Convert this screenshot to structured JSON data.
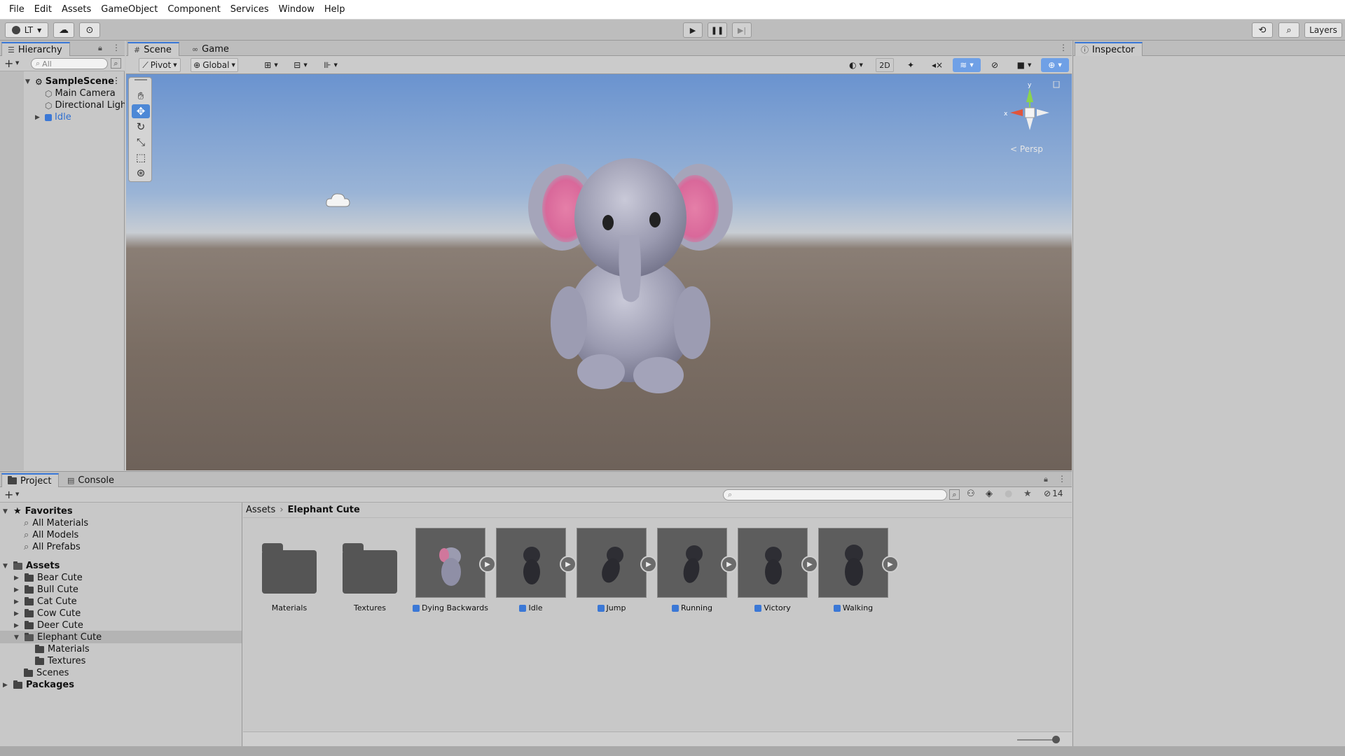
{
  "menu": [
    "File",
    "Edit",
    "Assets",
    "GameObject",
    "Component",
    "Services",
    "Window",
    "Help"
  ],
  "toolbar": {
    "account_label": "LT",
    "layers_label": "Layers"
  },
  "hierarchy": {
    "tab_label": "Hierarchy",
    "search_placeholder": "All",
    "scene_name": "SampleScene",
    "items": [
      "Main Camera",
      "Directional Ligh",
      "Idle"
    ]
  },
  "scene": {
    "tabs": [
      "Scene",
      "Game"
    ],
    "pivot_label": "Pivot",
    "global_label": "Global",
    "mode_2d_label": "2D",
    "persp_label": "Persp",
    "gizmo_x_label": "x",
    "gizmo_y_label": "y"
  },
  "inspector": {
    "tab_label": "Inspector"
  },
  "project": {
    "tabs": [
      "Project",
      "Console"
    ],
    "hidden_count": "14",
    "favorites_label": "Favorites",
    "favorites": [
      "All Materials",
      "All Models",
      "All Prefabs"
    ],
    "assets_label": "Assets",
    "asset_folders": [
      "Bear Cute",
      "Bull Cute",
      "Cat Cute",
      "Cow Cute",
      "Deer Cute",
      "Elephant Cute"
    ],
    "elephant_children": [
      "Materials",
      "Textures"
    ],
    "scenes_label": "Scenes",
    "packages_label": "Packages",
    "breadcrumb": [
      "Assets",
      "Elephant Cute"
    ],
    "grid_items": [
      "Materials",
      "Textures",
      "Dying Backwards",
      "Idle",
      "Jump",
      "Running",
      "Victory",
      "Walking"
    ]
  },
  "colors": {
    "accent": "#3a79d9",
    "selected_item": "#2f6fd0"
  }
}
